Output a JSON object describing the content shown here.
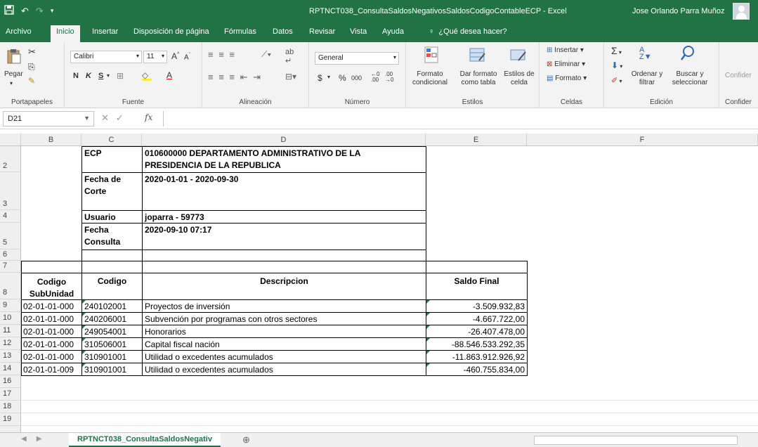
{
  "titlebar": {
    "title": "RPTNCT038_ConsultaSaldosNegativosSaldosCodigoContableECP - Excel",
    "user": "Jose Orlando Parra Muñoz"
  },
  "menu": {
    "tabs": [
      "Archivo",
      "Inicio",
      "Insertar",
      "Disposición de página",
      "Fórmulas",
      "Datos",
      "Revisar",
      "Vista",
      "Ayuda"
    ],
    "tell_me": "¿Qué desea hacer?"
  },
  "ribbon": {
    "clipboard": {
      "paste": "Pegar",
      "label": "Portapapeles"
    },
    "font": {
      "name": "Calibri",
      "size": "11",
      "label": "Fuente",
      "bold": "N",
      "italic": "K",
      "underline": "S"
    },
    "alignment": {
      "label": "Alineación"
    },
    "number": {
      "format": "General",
      "currency": "$",
      "percent": "%",
      "thousands": "000",
      "label": "Número"
    },
    "styles": {
      "conditional": "Formato condicional",
      "as_table": "Dar formato como tabla",
      "cell_styles": "Estilos de celda",
      "label": "Estilos"
    },
    "cells": {
      "insert": "Insertar",
      "delete": "Eliminar",
      "format": "Formato",
      "label": "Celdas"
    },
    "editing": {
      "sort": "Ordenar y filtrar",
      "find": "Buscar y seleccionar",
      "label": "Edición"
    },
    "confidential": "Confider"
  },
  "formula_bar": {
    "name_box": "D21",
    "fx": "fx",
    "value": ""
  },
  "columns": [
    "B",
    "C",
    "D",
    "E",
    "F"
  ],
  "rows": [
    "2",
    "3",
    "4",
    "5",
    "6",
    "7",
    "8",
    "9",
    "10",
    "11",
    "12",
    "13",
    "14",
    "16",
    "17",
    "18",
    "19"
  ],
  "header_block": {
    "ecp_label": "ECP",
    "ecp_value_1": "010600000 DEPARTAMENTO ADMINISTRATIVO DE LA",
    "ecp_value_2": "PRESIDENCIA DE LA REPUBLICA",
    "fecha_corte_label_1": "Fecha de",
    "fecha_corte_label_2": "Corte",
    "fecha_corte_value": "2020-01-01 - 2020-09-30",
    "usuario_label": "Usuario",
    "usuario_value": "joparra - 59773",
    "fecha_consulta_label_1": "Fecha",
    "fecha_consulta_label_2": "Consulta",
    "fecha_consulta_value": "2020-09-10 07:17"
  },
  "table": {
    "headers": {
      "subunidad_1": "Codigo",
      "subunidad_2": "SubUnidad",
      "codigo": "Codigo",
      "descripcion": "Descripcion",
      "saldo": "Saldo Final"
    },
    "rows": [
      {
        "subunidad": "02-01-01-000",
        "codigo": "240102001",
        "descripcion": "Proyectos de inversión",
        "saldo": "-3.509.932,83"
      },
      {
        "subunidad": "02-01-01-000",
        "codigo": "240206001",
        "descripcion": "Subvención por programas con otros sectores",
        "saldo": "-4.667.722,00"
      },
      {
        "subunidad": "02-01-01-000",
        "codigo": "249054001",
        "descripcion": "Honorarios",
        "saldo": "-26.407.478,00"
      },
      {
        "subunidad": "02-01-01-000",
        "codigo": "310506001",
        "descripcion": "Capital fiscal nación",
        "saldo": "-88.546.533.292,35"
      },
      {
        "subunidad": "02-01-01-000",
        "codigo": "310901001",
        "descripcion": "Utilidad o excedentes acumulados",
        "saldo": "-11.863.912.926,92"
      },
      {
        "subunidad": "02-01-01-009",
        "codigo": "310901001",
        "descripcion": "Utilidad o excedentes acumulados",
        "saldo": "-460.755.834,00"
      }
    ]
  },
  "sheet_tab": "RPTNCT038_ConsultaSaldosNegativ",
  "colors": {
    "excel_green": "#217346",
    "ribbon_bg": "#f3f3f3"
  }
}
